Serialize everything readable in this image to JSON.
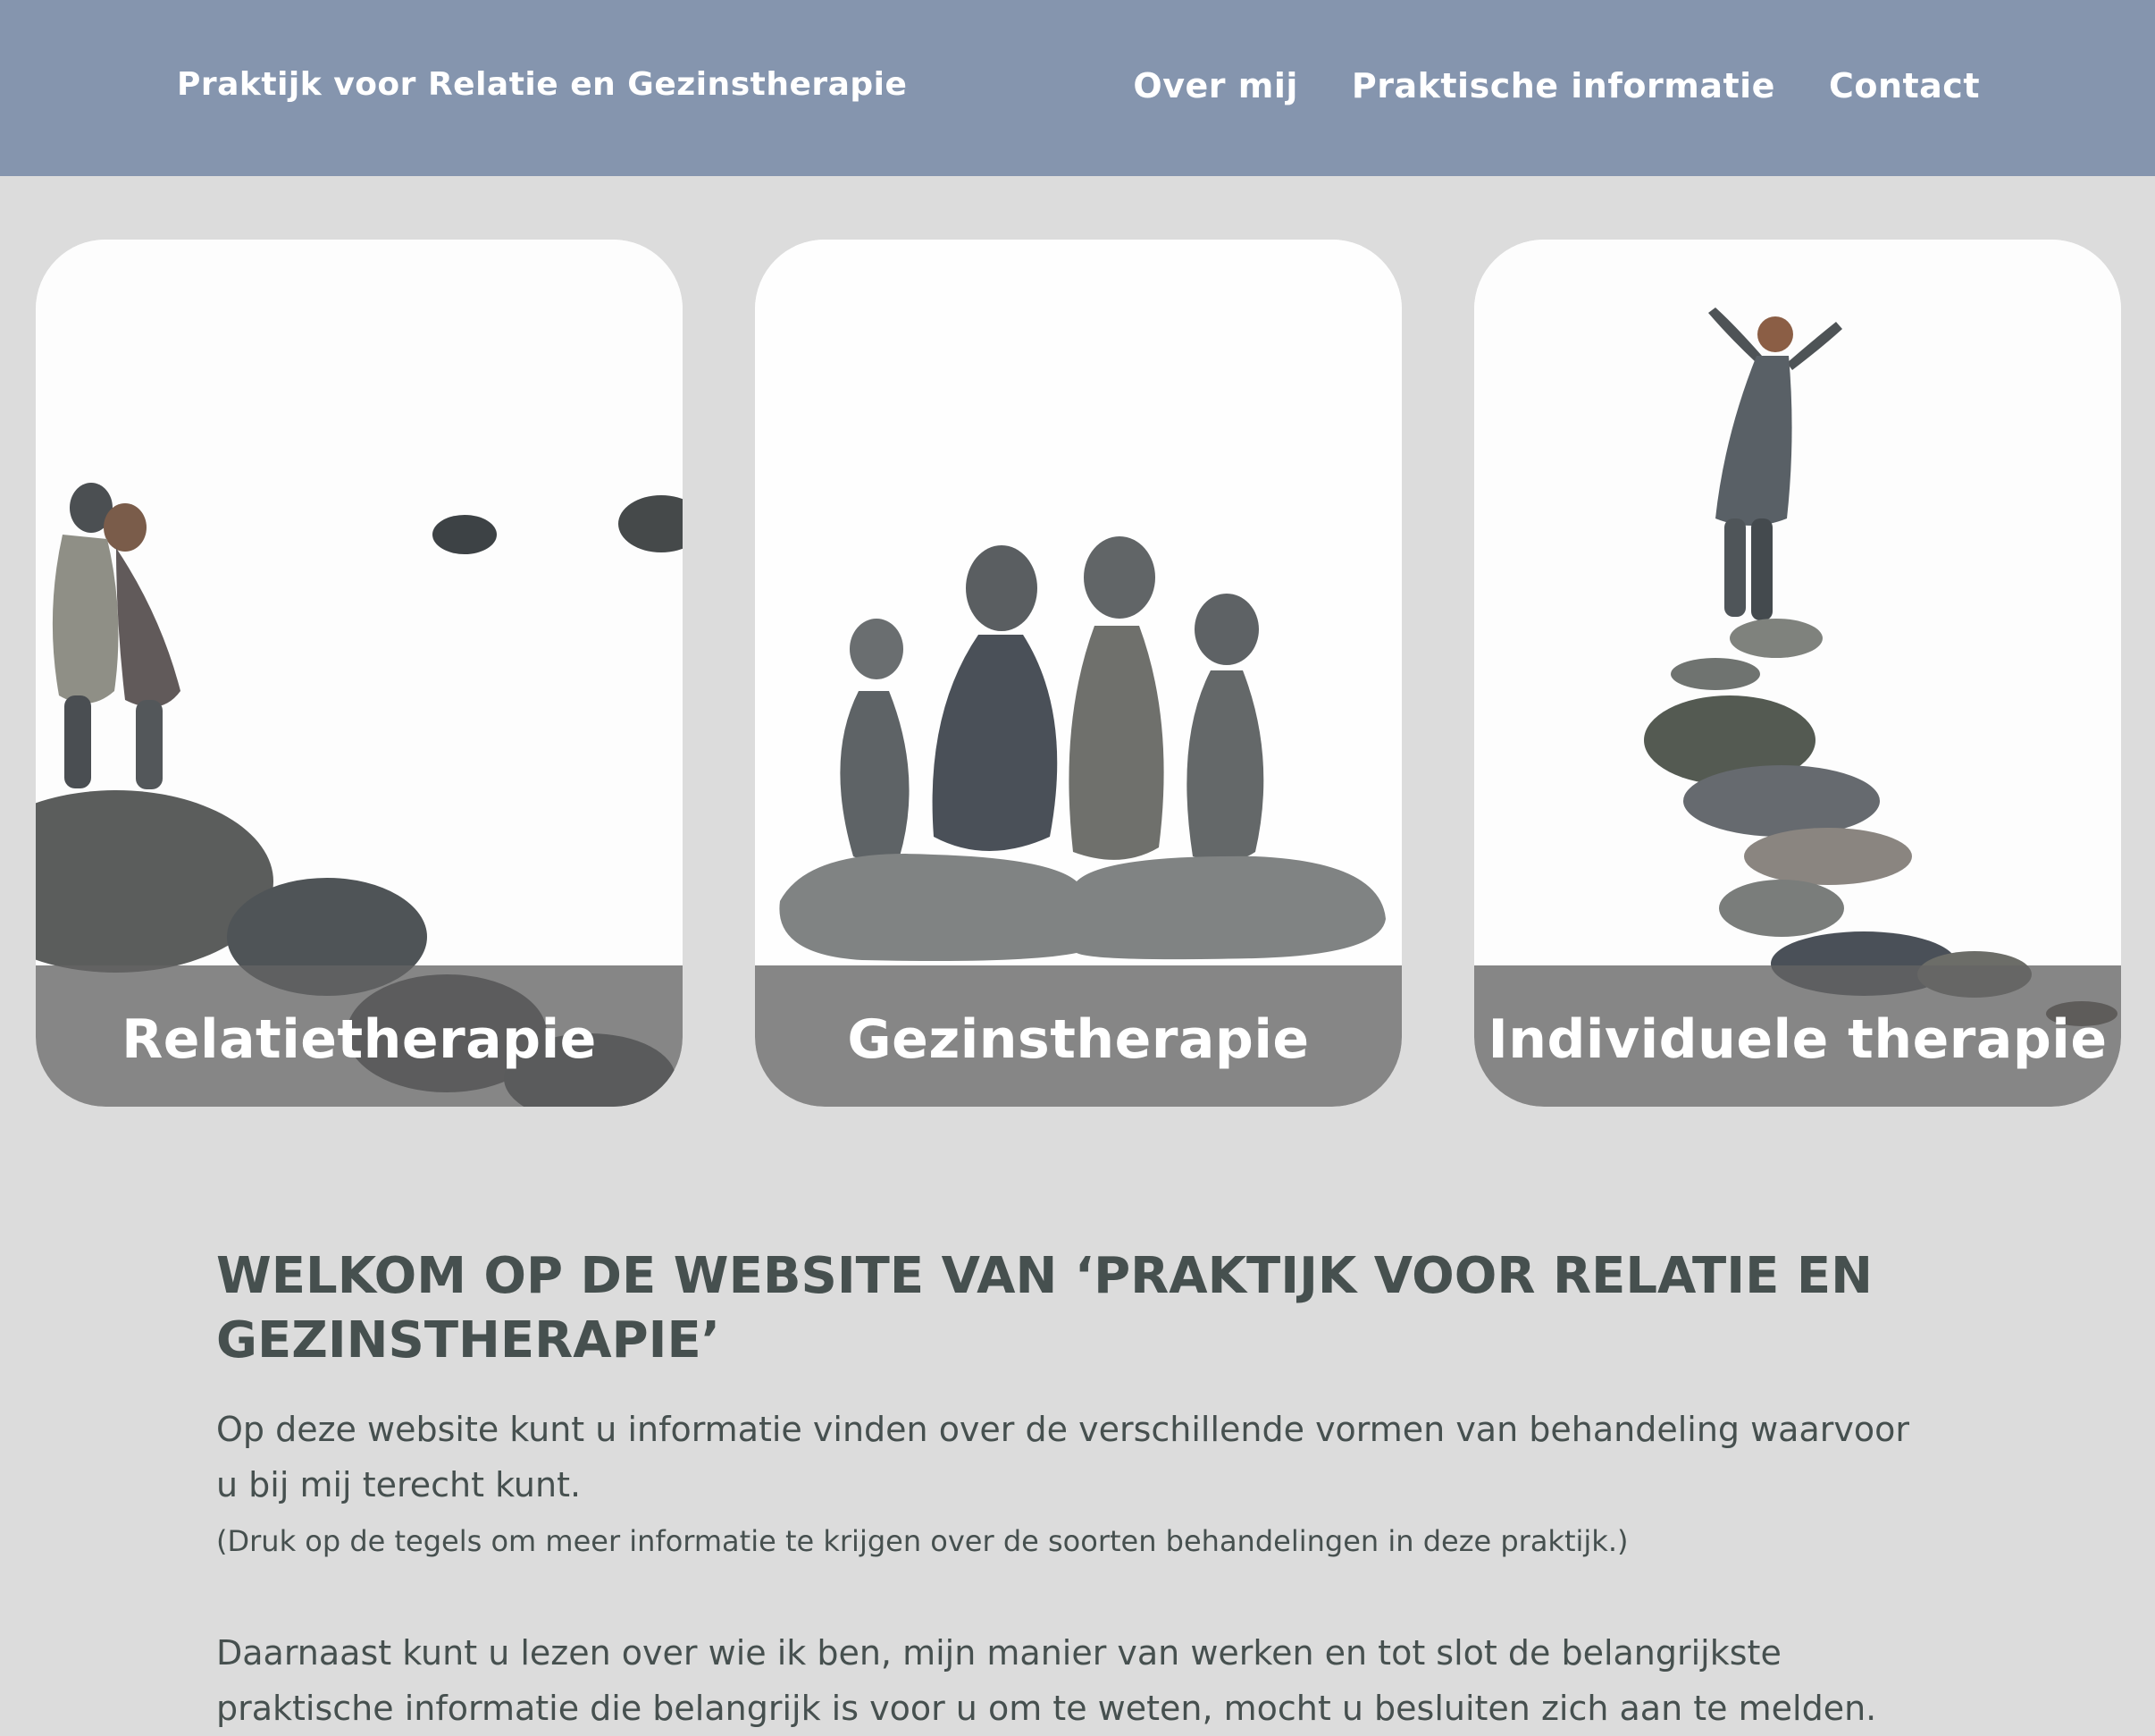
{
  "header": {
    "site_title": "Praktijk voor Relatie en Gezinstherapie",
    "nav": [
      {
        "label": "Over mij"
      },
      {
        "label": "Praktische informatie"
      },
      {
        "label": "Contact"
      }
    ],
    "background_color": "#8595ae"
  },
  "tiles": [
    {
      "label": "Relatietherapie"
    },
    {
      "label": "Gezinstherapie"
    },
    {
      "label": "Individuele therapie"
    }
  ],
  "content": {
    "heading": "WELKOM OP DE WEBSITE VAN ‘PRAKTIJK VOOR RELATIE EN GEZINSTHERAPIE’",
    "paragraph_1": "Op deze website kunt u informatie vinden over de verschillende vormen van behandeling waarvoor u bij mij terecht kunt.",
    "paragraph_2": "(Druk op de tegels om meer informatie te krijgen over de soorten behandelingen in deze praktijk.)",
    "paragraph_3": "Daarnaast kunt u lezen over wie ik ben, mijn manier van werken en tot slot de belangrijkste praktische informatie die belangrijk is voor u om te weten, mocht u besluiten zich aan te melden."
  },
  "colors": {
    "page_background": "#dcdcdc",
    "text": "#46504f",
    "tile_bar": "rgba(100,100,100,0.78)"
  }
}
